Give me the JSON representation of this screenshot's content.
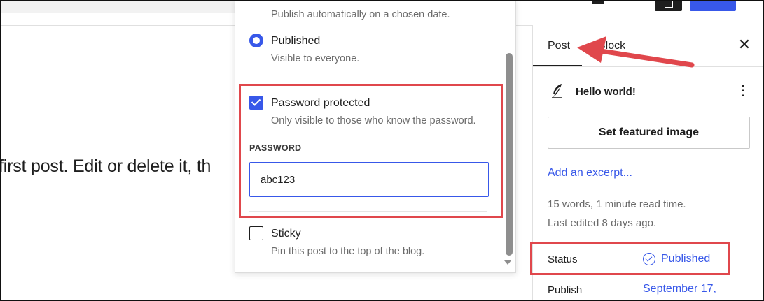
{
  "editor": {
    "content_text": "first post. Edit or delete it, th"
  },
  "visibility_popover": {
    "scheduled_desc": "Publish automatically on a chosen date.",
    "published_label": "Published",
    "published_desc": "Visible to everyone.",
    "password_protected_label": "Password protected",
    "password_protected_desc": "Only visible to those who know the password.",
    "password_field_label": "PASSWORD",
    "password_value": "abc123",
    "sticky_label": "Sticky",
    "sticky_desc": "Pin this post to the top of the blog."
  },
  "sidebar": {
    "tabs": [
      {
        "label": "Post",
        "active": true
      },
      {
        "label": "Block",
        "active": false
      }
    ],
    "post_title": "Hello world!",
    "featured_image_button": "Set featured image",
    "excerpt_link": "Add an excerpt...",
    "word_count": "15 words, 1 minute read time.",
    "last_edited": "Last edited 8 days ago.",
    "status_label": "Status",
    "status_value": "Published",
    "publish_label": "Publish",
    "publish_value": "September 17,"
  },
  "icons": {
    "close": "close-icon",
    "post": "feather-icon",
    "more": "kebab-menu-icon",
    "status": "check-circle-icon"
  },
  "colors": {
    "accent": "#3858e9",
    "annotation": "#e0474c",
    "muted_text": "#6b6b6b"
  }
}
